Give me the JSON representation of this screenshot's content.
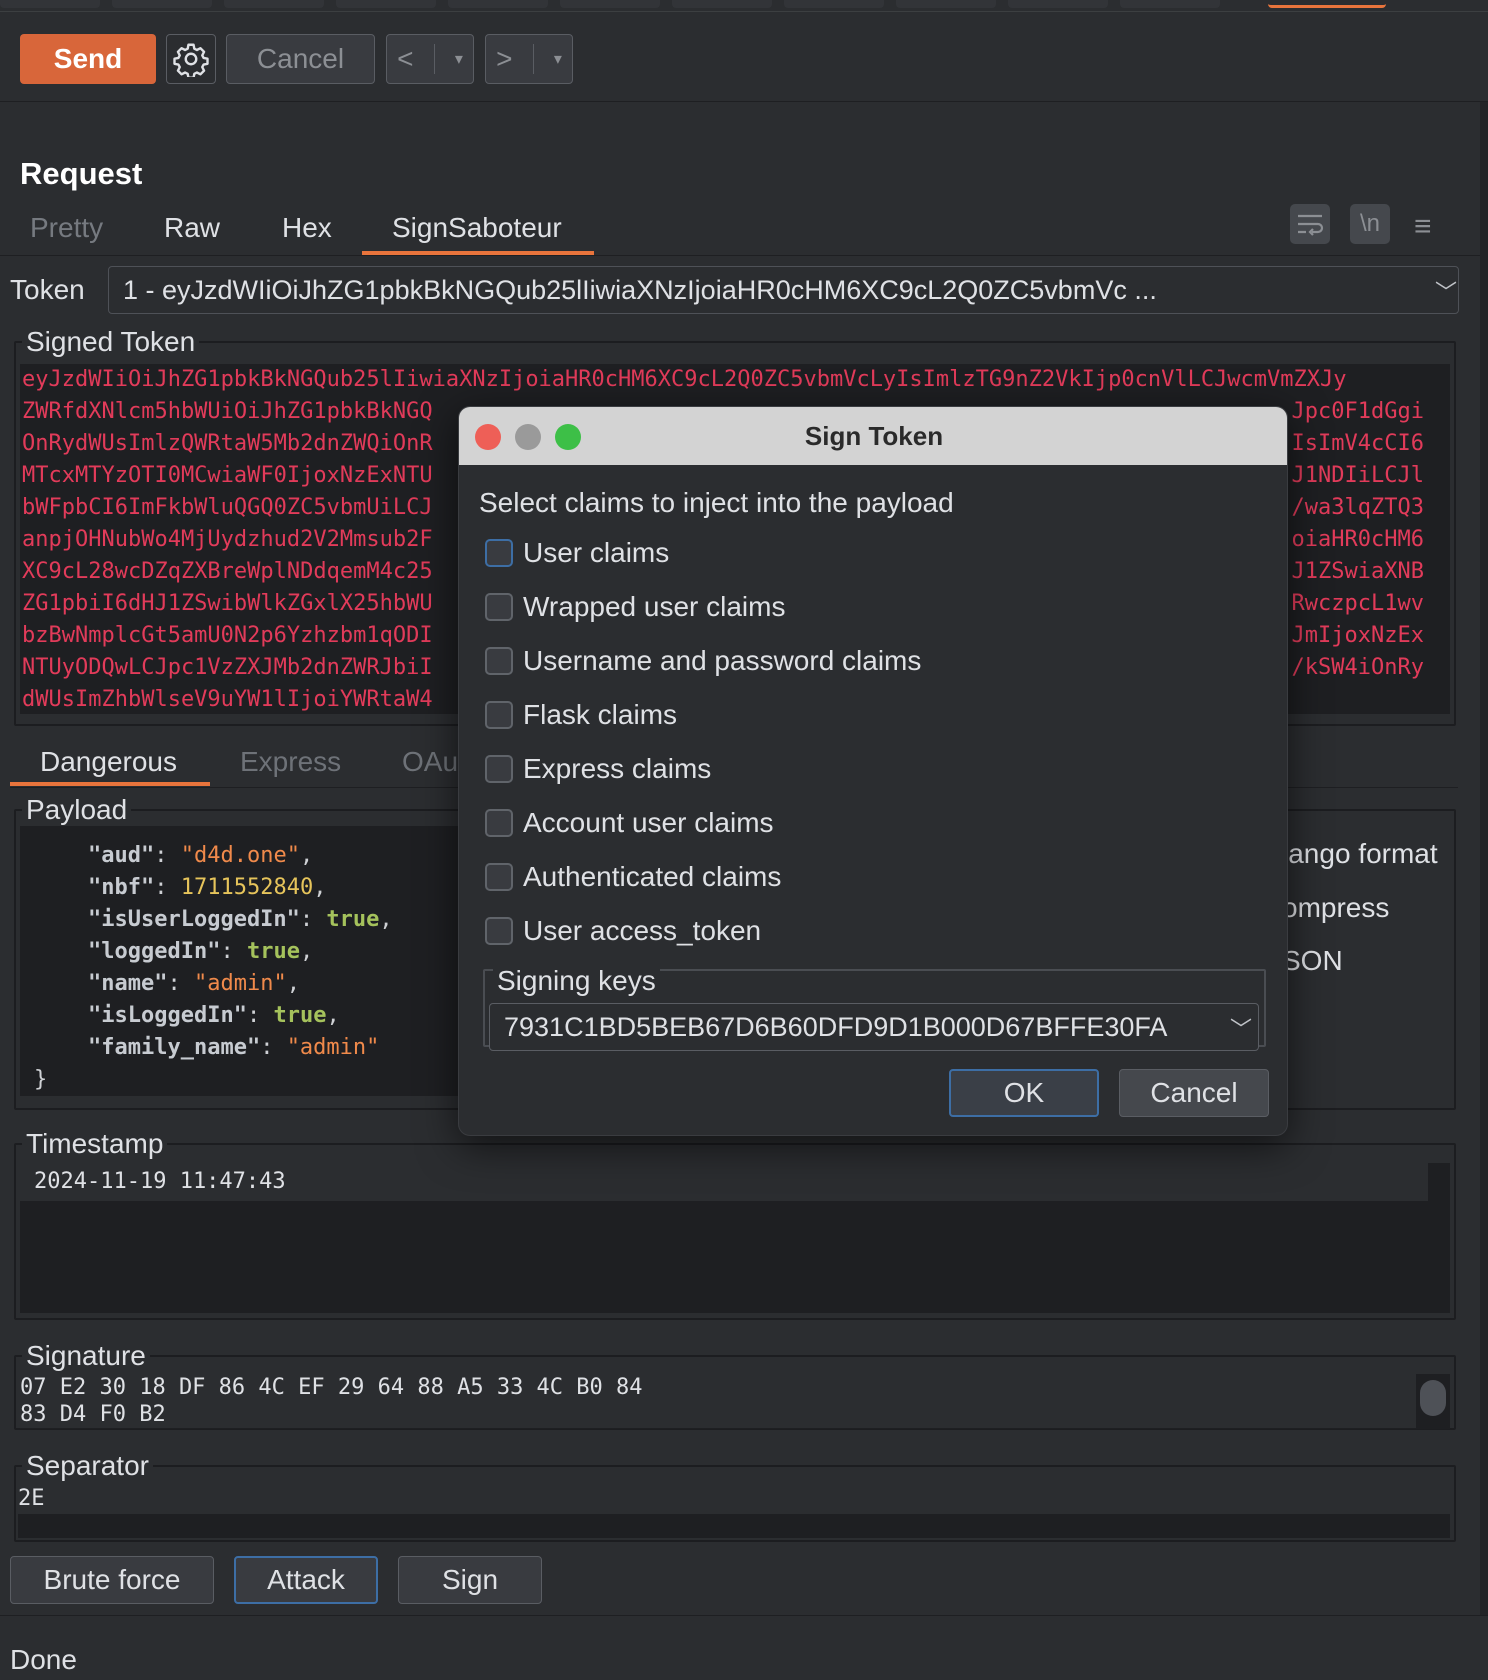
{
  "toolbar": {
    "send_label": "Send",
    "cancel_label": "Cancel",
    "back_glyph": "<",
    "forward_glyph": ">",
    "dropdown_glyph": "▾",
    "gear_icon": "gear-icon"
  },
  "request": {
    "title": "Request",
    "tabs": [
      {
        "label": "Pretty",
        "active": false
      },
      {
        "label": "Raw",
        "active": false
      },
      {
        "label": "Hex",
        "active": false
      },
      {
        "label": "SignSaboteur",
        "active": true
      }
    ],
    "newline_icon_text": "\\n"
  },
  "token": {
    "label": "Token",
    "selected": "1 - eyJzdWIiOiJhZG1pbkBkNGQub25lIiwiaXNzIjoiaHR0cHM6XC9cL2Q0ZC5vbmVc ..."
  },
  "signed_token": {
    "legend": "Signed Token",
    "lines": [
      "eyJzdWIiOiJhZG1pbkBkNGQub25lIiwiaXNzIjoiaHR0cHM6XC9cL2Q0ZC5vbmVcLyIsImlzTG9nZ2VkIjp0cnVlLCJwcmVmZXJy",
      "ZWRfdXNlcm5hbWUiOiJhZG1pbkBkNGQ",
      "OnRydWUsImlzQWRtaW5Mb2dnZWQiOnR",
      "MTcxMTYzOTI0MCwiaWF0IjoxNzExNTU",
      "bWFpbCI6ImFkbWluQGQ0ZC5vbmUiLCJ",
      "anpjOHNubWo4MjUydzhud2V2Mmsub2F",
      "XC9cL28wcDZqZXBreWplNDdqemM4c25",
      "ZG1pbiI6dHJ1ZSwibWlkZGxlX25hbWU",
      "bzBwNmplcGt5amU0N2p6Yzhzbm1qODI",
      "NTUyODQwLCJpc1VzZXJMb2dnZWRJbiI",
      "dWUsImZhbWlseV9uYW1lIjoiYWRtaW4"
    ],
    "right_lines": [
      "",
      "Jpc0F1dGgi",
      "IsImV4cCI6",
      "J1NDIiLCJl",
      "/wa3lqZTQ3",
      "oiaHR0cHM6",
      "J1ZSwiaXNB",
      "RwczpcL1wv",
      "JmIjoxNzEx",
      "/kSW4iOnRy",
      ""
    ]
  },
  "sub_tabs": [
    {
      "label": "Dangerous",
      "active": true
    },
    {
      "label": "Express",
      "active": false
    },
    {
      "label": "OAu",
      "active": false
    }
  ],
  "payload": {
    "legend": "Payload",
    "entries": [
      {
        "key": "\"aud\"",
        "value": "\"d4d.one\"",
        "type": "string"
      },
      {
        "key": "\"nbf\"",
        "value": "1711552840",
        "type": "number"
      },
      {
        "key": "\"isUserLoggedIn\"",
        "value": "true",
        "type": "bool"
      },
      {
        "key": "\"loggedIn\"",
        "value": "true",
        "type": "bool"
      },
      {
        "key": "\"name\"",
        "value": "\"admin\"",
        "type": "string"
      },
      {
        "key": "\"isLoggedIn\"",
        "value": "true",
        "type": "bool"
      },
      {
        "key": "\"family_name\"",
        "value": "\"admin\"",
        "type": "string",
        "last": true
      }
    ],
    "closing": "}"
  },
  "right_options": [
    "jango format",
    "ompress",
    "SON"
  ],
  "timestamp": {
    "legend": "Timestamp",
    "value": "2024-11-19 11:47:43"
  },
  "signature": {
    "legend": "Signature",
    "line1": "07 E2 30 18 DF 86 4C EF 29 64 88 A5 33 4C B0 84",
    "line2": "83 D4 F0 B2"
  },
  "separator": {
    "legend": "Separator",
    "value": "2E"
  },
  "actions": {
    "brute_force": "Brute force",
    "attack": "Attack",
    "sign": "Sign"
  },
  "status": "Done",
  "dialog": {
    "title": "Sign Token",
    "prompt": "Select claims to inject into the payload",
    "claims": [
      "User claims",
      "Wrapped user claims",
      "Username and password claims",
      "Flask claims",
      "Express claims",
      "Account user claims",
      "Authenticated claims",
      "User access_token"
    ],
    "signing_keys_legend": "Signing keys",
    "signing_key": "7931C1BD5BEB67D6B60DFD9D1B000D67BFFE30FA",
    "ok": "OK",
    "cancel": "Cancel"
  },
  "colors": {
    "accent": "#e8743c",
    "send": "#d8663a",
    "token_text": "#e23b5a"
  }
}
